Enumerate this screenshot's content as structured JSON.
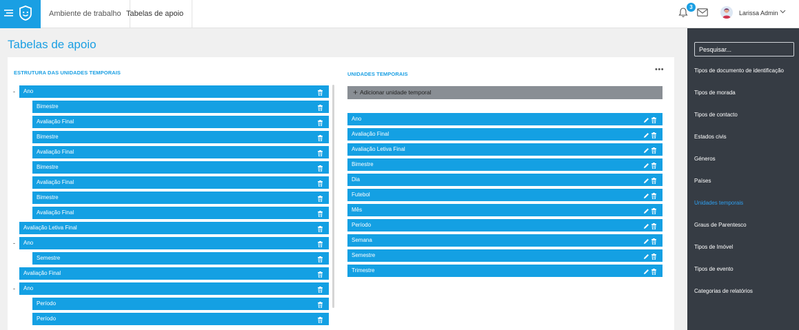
{
  "header": {
    "breadcrumbs": [
      "Ambiente de trabalho",
      "Tabelas de apoio"
    ],
    "notification_count": "3",
    "user_name": "Larissa Admin"
  },
  "page_title": "Tabelas de apoio",
  "structure": {
    "title": "Estrutura das unidades temporais",
    "rows": [
      {
        "label": "Ano",
        "level": 0,
        "toggle": "-"
      },
      {
        "label": "Bimestre",
        "level": 1,
        "toggle": ""
      },
      {
        "label": "Avaliação Final",
        "level": 1,
        "toggle": ""
      },
      {
        "label": "Bimestre",
        "level": 1,
        "toggle": ""
      },
      {
        "label": "Avaliação Final",
        "level": 1,
        "toggle": ""
      },
      {
        "label": "Bimestre",
        "level": 1,
        "toggle": ""
      },
      {
        "label": "Avaliação Final",
        "level": 1,
        "toggle": ""
      },
      {
        "label": "Bimestre",
        "level": 1,
        "toggle": ""
      },
      {
        "label": "Avaliação Final",
        "level": 1,
        "toggle": ""
      },
      {
        "label": "Avaliação Letiva Final",
        "level": 0,
        "toggle": ""
      },
      {
        "label": "Ano",
        "level": 0,
        "toggle": "-"
      },
      {
        "label": "Semestre",
        "level": 1,
        "toggle": ""
      },
      {
        "label": "Avaliação Final",
        "level": 0,
        "toggle": ""
      },
      {
        "label": "Ano",
        "level": 0,
        "toggle": "-"
      },
      {
        "label": "Período",
        "level": 1,
        "toggle": ""
      },
      {
        "label": "Período",
        "level": 1,
        "toggle": ""
      }
    ]
  },
  "units": {
    "title": "Unidades temporais",
    "add_label": "Adicionar unidade temporal",
    "items": [
      "Ano",
      "Avaliação Final",
      "Avaliação Letiva Final",
      "Bimestre",
      "Dia",
      "Futebol",
      "Mês",
      "Período",
      "Semana",
      "Semestre",
      "Trimestre"
    ]
  },
  "sidebar": {
    "search_placeholder": "Pesquisar...",
    "items": [
      {
        "label": "Tipos de documento de identificação",
        "active": false
      },
      {
        "label": "Tipos de morada",
        "active": false
      },
      {
        "label": "Tipos de contacto",
        "active": false
      },
      {
        "label": "Estados civis",
        "active": false
      },
      {
        "label": "Géneros",
        "active": false
      },
      {
        "label": "Países",
        "active": false
      },
      {
        "label": "Unidades temporais",
        "active": true
      },
      {
        "label": "Graus de Parentesco",
        "active": false
      },
      {
        "label": "Tipos de Imóvel",
        "active": false
      },
      {
        "label": "Tipos de evento",
        "active": false
      },
      {
        "label": "Categorias de relatórios",
        "active": false
      }
    ]
  },
  "colors": {
    "brand": "#1a9fe3",
    "sidebar_bg": "#363c44",
    "row_bg": "#14a0e3",
    "add_button_bg": "#898e94"
  },
  "icons": {
    "menu": "menu-icon",
    "logo": "shield-logo-icon",
    "notifications": "bell-icon",
    "messages": "envelope-icon",
    "row_delete": "trash-icon",
    "row_edit": "pencil-icon",
    "more": "more-dots-icon",
    "add": "plus-icon"
  }
}
